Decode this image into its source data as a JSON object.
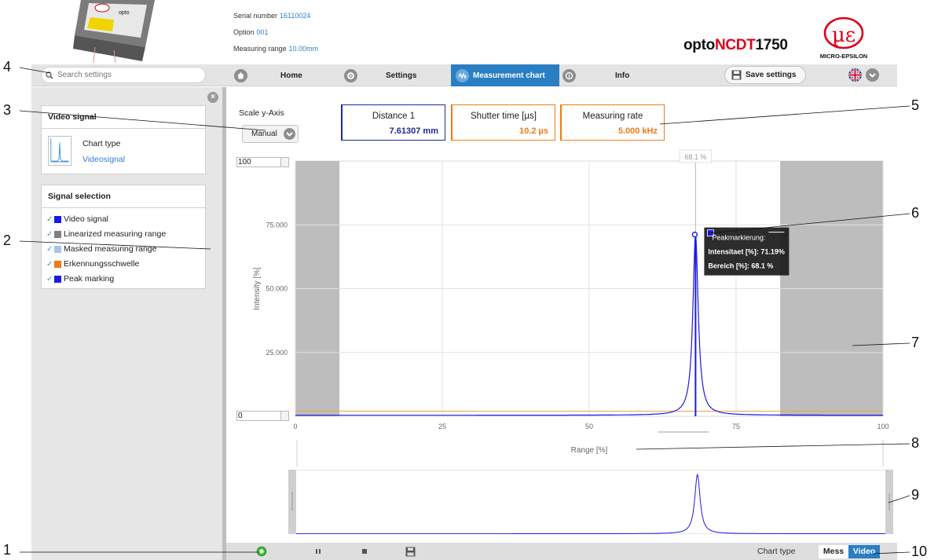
{
  "device": {
    "serial_label": "Serial number",
    "serial_value": "16110024",
    "option_label": "Option",
    "option_value": "001",
    "range_label": "Measuring range",
    "range_value": "10.00mm",
    "brand_prefix": "opto",
    "brand_red": "NCDT",
    "brand_suffix": "1750",
    "logo_text": "MICRO-EPSILON",
    "logo_icon": "micro-epsilon-logo"
  },
  "nav": {
    "search_placeholder": "Search settings",
    "home": "Home",
    "settings": "Settings",
    "chart": "Measurement chart",
    "info": "Info",
    "save": "Save settings"
  },
  "panel": {
    "video_title": "Video signal",
    "chart_type_label": "Chart type",
    "chart_type_value": "Videosignal",
    "signal_title": "Signal selection",
    "signals": [
      {
        "label": "Video signal",
        "color": "#1a1ae6"
      },
      {
        "label": "Linearized measuring range",
        "color": "#808080"
      },
      {
        "label": "Masked measuring range",
        "color": "#a9c4e8"
      },
      {
        "label": "Erkennungsschwelle",
        "color": "#f07a17"
      },
      {
        "label": "Peak marking",
        "color": "#1a1ae6"
      }
    ]
  },
  "main": {
    "scale_label": "Scale y-Axis",
    "scale_value": "Manual",
    "values": [
      {
        "label": "Distance 1",
        "value": "7.61307  mm",
        "color": "#1c2a9a"
      },
      {
        "label": "Shutter time [µs]",
        "value": "10.2  µs",
        "color": "#f07a17"
      },
      {
        "label": "Measuring rate",
        "value": "5.000  kHz",
        "color": "#f07a17"
      }
    ],
    "y_max_input": "100",
    "y_min_input": "0"
  },
  "chart_data": {
    "type": "line",
    "title": "",
    "xlabel": "Range [%]",
    "ylabel": "Intensity [%]",
    "xlim": [
      0,
      100
    ],
    "ylim": [
      0,
      100
    ],
    "x_ticks": [
      "0",
      "25",
      "50",
      "75",
      "100"
    ],
    "y_ticks": [
      "25.000",
      "50.000",
      "75.000"
    ],
    "masked_ranges": [
      [
        0,
        7.5
      ],
      [
        82.5,
        100
      ]
    ],
    "threshold": 2,
    "peak_x": 68.1,
    "peak_y": 71.19,
    "baseline": 0.4,
    "cursor_label": "68.1 %",
    "tooltip_title": "Peakmarkierung:",
    "tooltip_line1": "Intensitaet [%]: 71.19%",
    "tooltip_line2": "Bereich [%]: 68.1 %",
    "series": [
      {
        "values": []
      }
    ]
  },
  "bottom": {
    "chart_type_label": "Chart type",
    "mode_mess": "Mess",
    "mode_video": "Video"
  },
  "callouts": [
    "1",
    "2",
    "3",
    "4",
    "5",
    "6",
    "7",
    "8",
    "9",
    "10"
  ]
}
